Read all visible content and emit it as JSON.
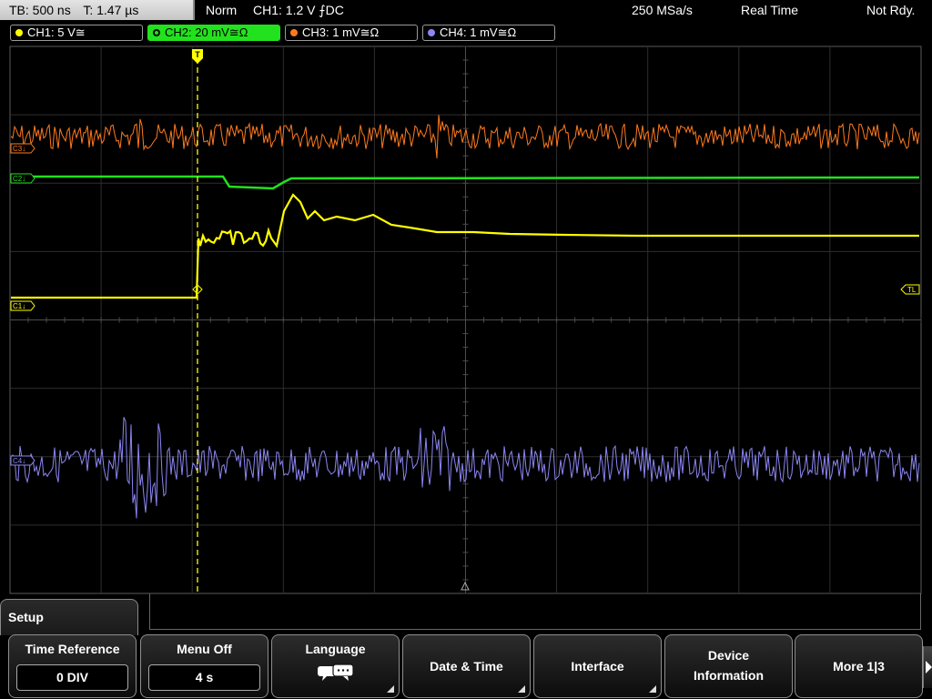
{
  "status": {
    "tb": "TB: 500 ns",
    "t": "T: 1.47 µs",
    "mode": "Norm",
    "trigger": "CH1: 1.2 V ⨍DC",
    "sample_rate": "250 MSa/s",
    "acq": "Real Time",
    "state": "Not Rdy."
  },
  "channels": [
    {
      "label": "CH1: 5 V≅",
      "color": "#ffff00"
    },
    {
      "label": "CH2: 20 mV≅Ω",
      "color": "#22e21e"
    },
    {
      "label": "CH3: 1 mV≅Ω",
      "color": "#ff7a1e"
    },
    {
      "label": "CH4: 1 mV≅Ω",
      "color": "#8c86f2"
    }
  ],
  "markers": {
    "c3": "C3↓",
    "c2": "C2↓",
    "c1": "C1↓",
    "c4": "C4↓",
    "trigger_level": "TL",
    "trigger_pos": "T"
  },
  "menu": {
    "title": "Setup",
    "softkeys": [
      {
        "label": "Time Reference",
        "value": "0 DIV"
      },
      {
        "label": "Menu Off",
        "value": "4 s"
      },
      {
        "label": "Language",
        "icon": "speech-bubbles-icon"
      },
      {
        "label": "Date & Time"
      },
      {
        "label": "Interface"
      },
      {
        "label": "Device",
        "label2": "Information"
      },
      {
        "label": "More 1|3"
      }
    ]
  }
}
